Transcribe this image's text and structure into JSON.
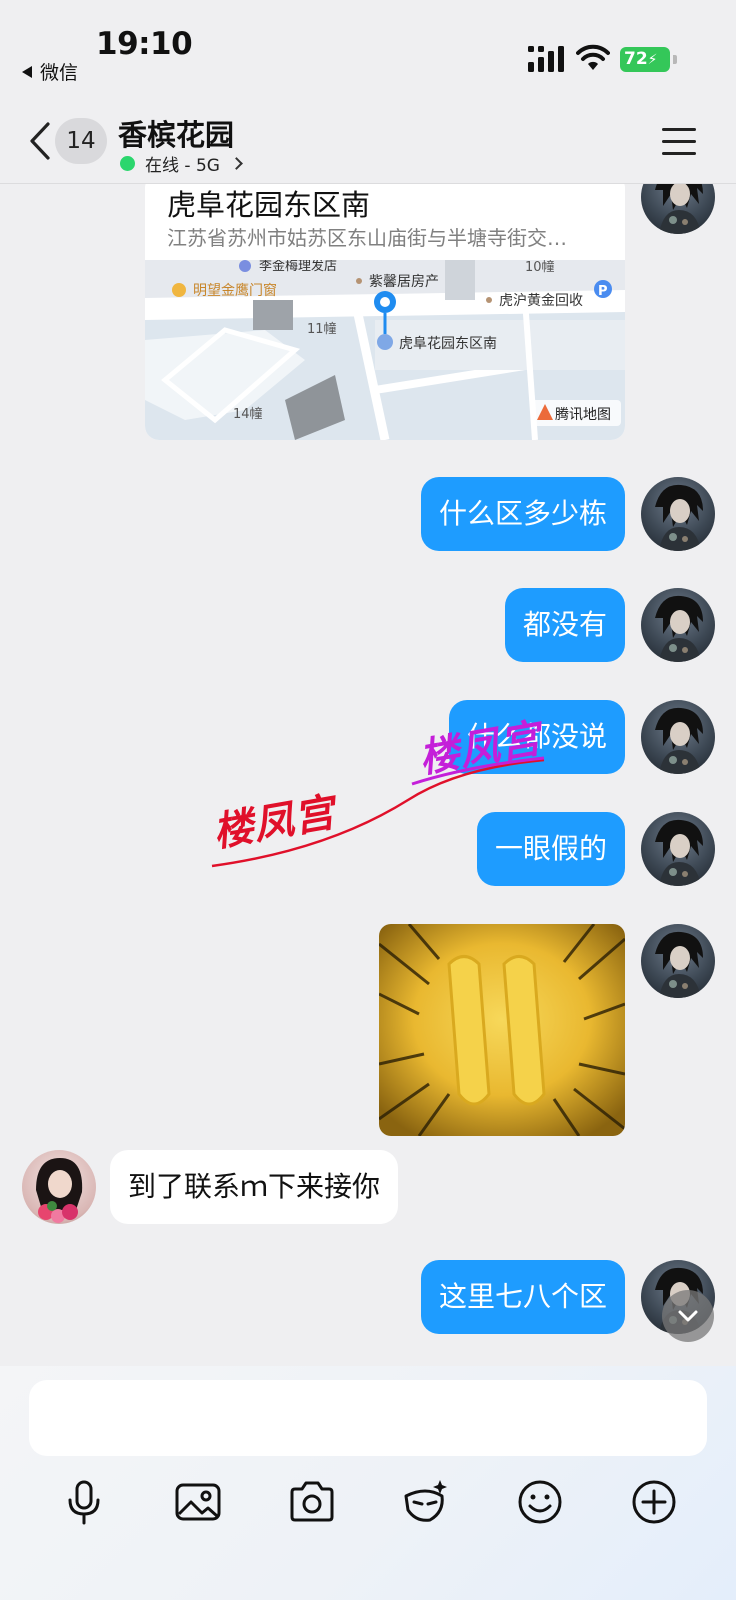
{
  "status_bar": {
    "time": "19:10",
    "back_app": "微信",
    "battery": "72"
  },
  "header": {
    "unread_count": "14",
    "title": "香槟花园",
    "status": "在线 - 5G"
  },
  "location_card": {
    "name": "虎阜花园东区南",
    "address": "江苏省苏州市姑苏区东山庙街与半塘寺街交…",
    "map_labels": {
      "shop1": "明望金鹰门窗",
      "shop2": "紫馨居房产",
      "shop3": "虎沪黄金回收",
      "top_partial": "李金梅理发店",
      "building_10": "10幢",
      "building_11": "11幢",
      "building_14": "14幢",
      "pin_label": "虎阜花园东区南",
      "provider": "腾讯地图"
    }
  },
  "messages": [
    {
      "from": "me",
      "text": "什么区多少栋"
    },
    {
      "from": "me",
      "text": "都没有"
    },
    {
      "from": "me",
      "text": "什么都没说"
    },
    {
      "from": "me",
      "text": "一眼假的"
    },
    {
      "from": "me",
      "type": "sticker"
    },
    {
      "from": "other",
      "text": "到了联系ｍ下来接你"
    },
    {
      "from": "me",
      "text": "这里七八个区"
    }
  ],
  "watermark": {
    "text1": "楼凤宫",
    "text2": "楼凤宫"
  },
  "input": {
    "placeholder": ""
  },
  "toolbar": {
    "icons": [
      "microphone-icon",
      "image-icon",
      "camera-icon",
      "mask-icon",
      "emoji-icon",
      "plus-icon"
    ]
  },
  "colors": {
    "my_bubble": "#1e9cff",
    "other_bubble": "#ffffff",
    "online": "#2bd66d",
    "battery": "#34c759"
  }
}
